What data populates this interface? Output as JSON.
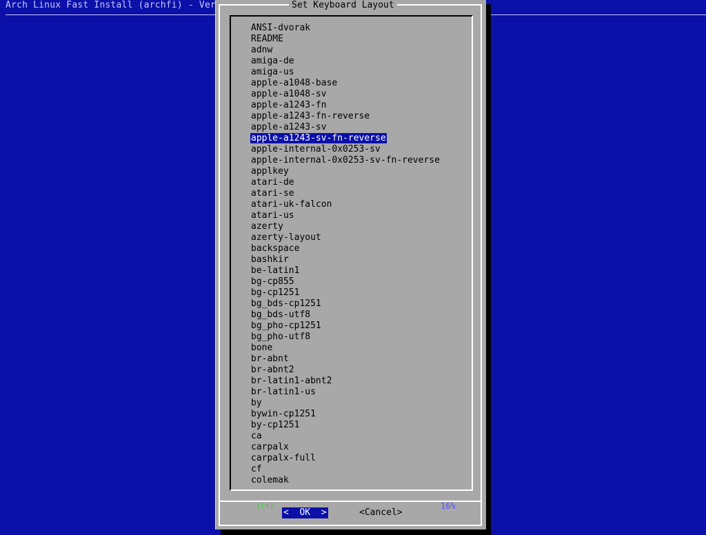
{
  "backtitle": "Arch Linux Fast Install (archfi) - Ver",
  "dialog": {
    "title": "Set Keyboard Layout",
    "items": [
      "ANSI-dvorak",
      "README",
      "adnw",
      "amiga-de",
      "amiga-us",
      "apple-a1048-base",
      "apple-a1048-sv",
      "apple-a1243-fn",
      "apple-a1243-fn-reverse",
      "apple-a1243-sv",
      "apple-a1243-sv-fn-reverse",
      "apple-internal-0x0253-sv",
      "apple-internal-0x0253-sv-fn-reverse",
      "applkey",
      "atari-de",
      "atari-se",
      "atari-uk-falcon",
      "atari-us",
      "azerty",
      "azerty-layout",
      "backspace",
      "bashkir",
      "be-latin1",
      "bg-cp855",
      "bg-cp1251",
      "bg_bds-cp1251",
      "bg_bds-utf8",
      "bg_pho-cp1251",
      "bg_pho-utf8",
      "bone",
      "br-abnt",
      "br-abnt2",
      "br-latin1-abnt2",
      "br-latin1-us",
      "by",
      "bywin-cp1251",
      "by-cp1251",
      "ca",
      "carpalx",
      "carpalx-full",
      "cf",
      "colemak"
    ],
    "selected_index": 10,
    "scroll_indicator": "↓(+)",
    "scroll_percent": "16%",
    "ok_label": "<  OK  >",
    "cancel_label": "<Cancel>"
  },
  "colors": {
    "background": "#0b10a8",
    "dialog": "#a8a8a8",
    "highlight": "#0b10a8",
    "scroll_indicator": "#30d030",
    "scroll_percent": "#5050ff"
  }
}
